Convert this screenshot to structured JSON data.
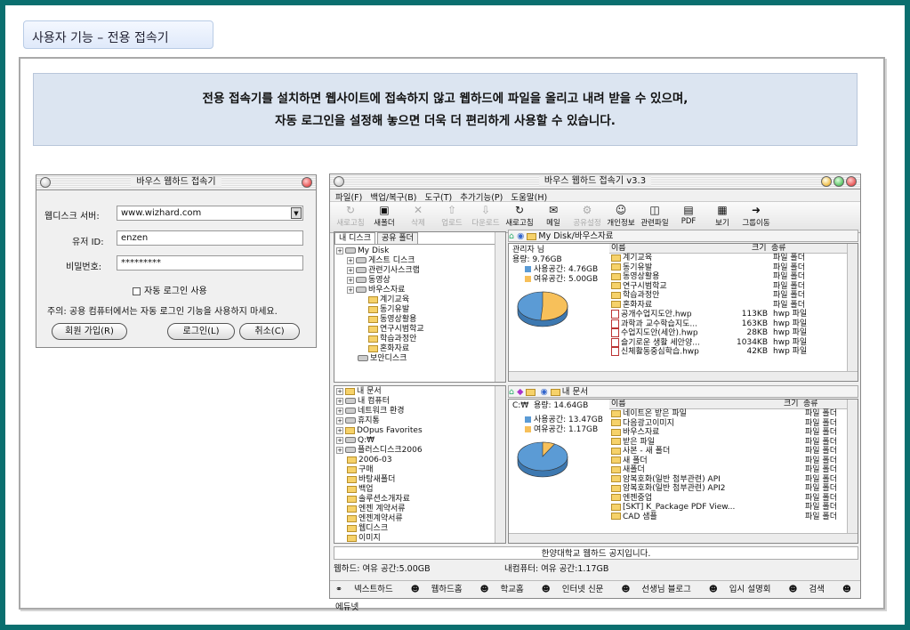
{
  "slide_title": "사용자 기능 – 전용 접속기",
  "intro": {
    "line1": "전용 접속기를 설치하면 웹사이트에 접속하지 않고 웹하드에 파일을 올리고 내려 받을 수 있으며,",
    "line2": "자동 로그인을 설정해 놓으면 더욱 더 편리하게 사용할 수 있습니다."
  },
  "login": {
    "title": "바우스 웹하드 접속기",
    "server_label": "웹디스크 서버:",
    "server_value": "www.wizhard.com",
    "id_label": "유저 ID:",
    "id_value": "enzen",
    "pw_label": "비밀번호:",
    "pw_value": "*********",
    "auto_login_label": "자동 로그인 사용",
    "notice": "주의: 공용 컴퓨터에서는 자동 로그인 기능을 사용하지 마세요.",
    "btn_join": "회원 가입(R)",
    "btn_login": "로그인(L)",
    "btn_cancel": "취소(C)"
  },
  "app": {
    "title": "바우스 웹하드 접속기 v3.3",
    "menu": [
      "파일(F)",
      "백업/복구(B)",
      "도구(T)",
      "추가기능(P)",
      "도움말(H)"
    ],
    "toolbar": [
      {
        "label": "새로고침",
        "icon": "↻",
        "dim": true
      },
      {
        "label": "새폴더",
        "icon": "▣",
        "dim": false
      },
      {
        "label": "삭제",
        "icon": "✕",
        "dim": true
      },
      {
        "label": "업로드",
        "icon": "⇧",
        "dim": true
      },
      {
        "label": "다운로드",
        "icon": "⇩",
        "dim": true
      },
      {
        "label": "새로고침",
        "icon": "↻",
        "dim": false
      },
      {
        "label": "메일",
        "icon": "✉",
        "dim": false
      },
      {
        "label": "공유설정",
        "icon": "⚙",
        "dim": true
      },
      {
        "label": "개인정보",
        "icon": "☺",
        "dim": false
      },
      {
        "label": "관련파일",
        "icon": "◫",
        "dim": false
      },
      {
        "label": "PDF",
        "icon": "▤",
        "dim": false
      },
      {
        "label": "보기",
        "icon": "▦",
        "dim": false
      },
      {
        "label": "그룹이동",
        "icon": "➜",
        "dim": false
      }
    ],
    "top_tabs": [
      "내 디스크",
      "공유 폴더"
    ],
    "top_tree": [
      {
        "label": "My Disk",
        "type": "drive",
        "indent": 0
      },
      {
        "label": "게스트 디스크",
        "type": "drive",
        "indent": 1
      },
      {
        "label": "관련기사스크랩",
        "type": "drive",
        "indent": 1
      },
      {
        "label": "동영상",
        "type": "drive",
        "indent": 1
      },
      {
        "label": "바우스자료",
        "type": "drive",
        "indent": 1
      },
      {
        "label": "계기교육",
        "type": "folder",
        "indent": 3
      },
      {
        "label": "동기유발",
        "type": "folder",
        "indent": 3
      },
      {
        "label": "동영상활용",
        "type": "folder",
        "indent": 3
      },
      {
        "label": "연구시범학교",
        "type": "folder",
        "indent": 3
      },
      {
        "label": "학습과정안",
        "type": "folder",
        "indent": 3
      },
      {
        "label": "혼화자료",
        "type": "folder",
        "indent": 3
      },
      {
        "label": "보안디스크",
        "type": "drive",
        "indent": 2
      }
    ],
    "top_path": "My Disk/바우스자료",
    "top_info": {
      "owner": "관리자 님",
      "capacity": "용량: 9.76GB",
      "used": "사용공간: 4.76GB",
      "free": "여유공간: 5.00GB"
    },
    "header": {
      "name": "이름",
      "size": "크기",
      "kind": "종류"
    },
    "top_files": [
      {
        "name": "계기교육",
        "size": "",
        "kind": "파일 폴더",
        "type": "folder"
      },
      {
        "name": "동기유발",
        "size": "",
        "kind": "파일 폴더",
        "type": "folder"
      },
      {
        "name": "동영상활용",
        "size": "",
        "kind": "파일 폴더",
        "type": "folder"
      },
      {
        "name": "연구시범학교",
        "size": "",
        "kind": "파일 폴더",
        "type": "folder"
      },
      {
        "name": "학습과정안",
        "size": "",
        "kind": "파일 폴더",
        "type": "folder"
      },
      {
        "name": "혼화자료",
        "size": "",
        "kind": "파일 폴더",
        "type": "folder"
      },
      {
        "name": "공개수업지도안.hwp",
        "size": "113KB",
        "kind": "hwp 파일",
        "type": "hwp"
      },
      {
        "name": "과학과 교수학습지도...",
        "size": "163KB",
        "kind": "hwp 파일",
        "type": "hwp"
      },
      {
        "name": "수업지도안(세안).hwp",
        "size": "28KB",
        "kind": "hwp 파일",
        "type": "hwp"
      },
      {
        "name": "슬기로운 생활 세안양...",
        "size": "1034KB",
        "kind": "hwp 파일",
        "type": "hwp"
      },
      {
        "name": "신체활동중심학습.hwp",
        "size": "42KB",
        "kind": "hwp 파일",
        "type": "hwp"
      }
    ],
    "bottom_tree": [
      {
        "label": "내 문서",
        "type": "folder"
      },
      {
        "label": "내 컴퓨터",
        "type": "drive"
      },
      {
        "label": "네트워크 환경",
        "type": "drive"
      },
      {
        "label": "휴지통",
        "type": "drive"
      },
      {
        "label": "DOpus Favorites",
        "type": "folder"
      },
      {
        "label": "Q:₩",
        "type": "drive"
      },
      {
        "label": "플러스디스크2006",
        "type": "drive"
      },
      {
        "label": "2006-03",
        "type": "folder"
      },
      {
        "label": "구매",
        "type": "folder"
      },
      {
        "label": "바탕새폴더",
        "type": "folder"
      },
      {
        "label": "백업",
        "type": "folder"
      },
      {
        "label": "솔루션소개자료",
        "type": "folder"
      },
      {
        "label": "엔젠 계약서류",
        "type": "folder"
      },
      {
        "label": "엔젠계약서류",
        "type": "folder"
      },
      {
        "label": "웹디스크",
        "type": "folder"
      },
      {
        "label": "이미지",
        "type": "folder"
      }
    ],
    "bottom_path": "내 문서",
    "bottom_info": {
      "drive": "C:₩",
      "capacity": "용량: 14.64GB",
      "used": "사용공간: 13.47GB",
      "free": "여유공간: 1.17GB"
    },
    "bottom_files": [
      {
        "name": "네이트온 받은 파일",
        "kind": "파일 폴더"
      },
      {
        "name": "다음광고이미지",
        "kind": "파일 폴더"
      },
      {
        "name": "바우스자료",
        "kind": "파일 폴더"
      },
      {
        "name": "받은 파일",
        "kind": "파일 폴더"
      },
      {
        "name": "사본 - 새 폴더",
        "kind": "파일 폴더"
      },
      {
        "name": "새 폴더",
        "kind": "파일 폴더"
      },
      {
        "name": "새폴더",
        "kind": "파일 폴더"
      },
      {
        "name": "암복호화(일반 첨부관련) API",
        "kind": "파일 폴더"
      },
      {
        "name": "암복호화(일반 첨부관련) API2",
        "kind": "파일 폴더"
      },
      {
        "name": "엔젠중업",
        "kind": "파일 폴더"
      },
      {
        "name": "[SKT] K_Package PDF View...",
        "kind": "파일 폴더"
      },
      {
        "name": "CAD 샘플",
        "kind": "파일 폴더"
      }
    ],
    "notice_bar": "한양대학교 웹하드 공지입니다.",
    "status_webhard": "웹하드:  여유 공간:5.00GB",
    "status_pc": "내컴퓨터:  여유 공간:1.17GB",
    "taskbar": [
      "넥스트하드",
      "웹하드홈",
      "학교홈",
      "인터넷 신문",
      "선생님 블로그",
      "입시 설명회",
      "검색",
      "에듀넷"
    ]
  },
  "colors": {
    "used": "#5b9bd5",
    "free": "#f7c05a",
    "background": "#0a6f6f"
  },
  "pies": [
    {
      "used": 4.76,
      "free": 5.0
    },
    {
      "used": 13.47,
      "free": 1.17
    }
  ]
}
